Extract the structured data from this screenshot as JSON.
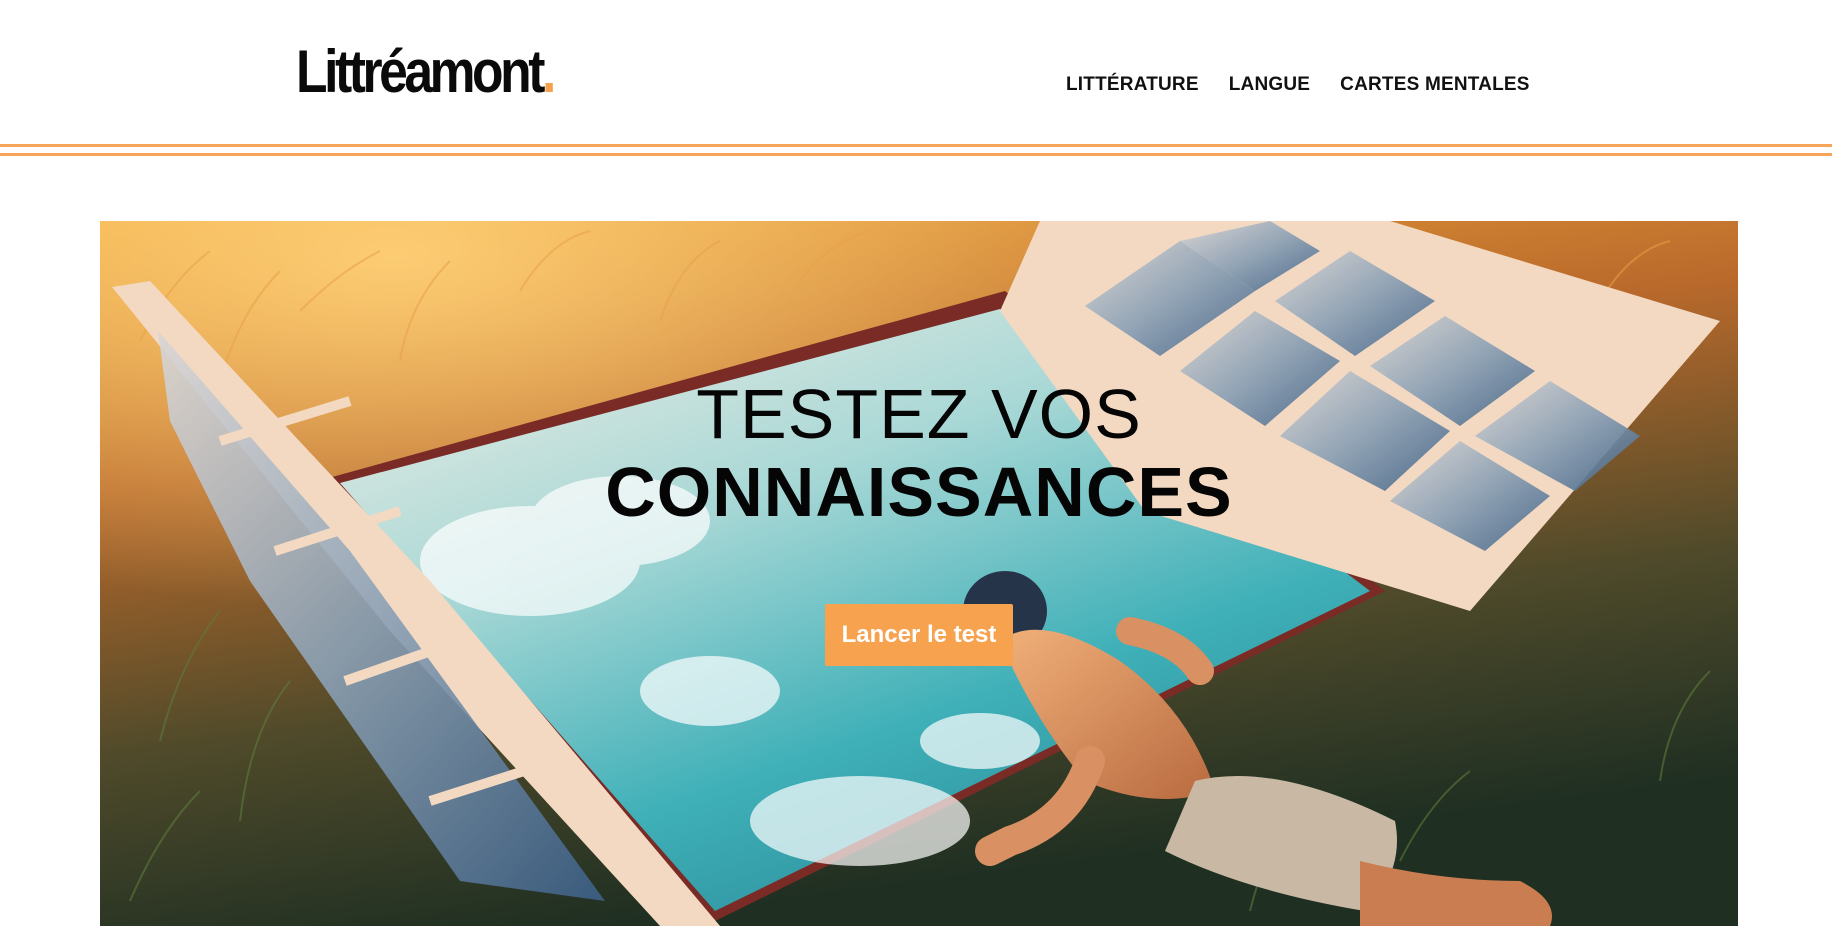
{
  "header": {
    "logo_text": "Littréamont",
    "logo_dot": ".",
    "nav": [
      {
        "label": "LITTÉRATURE"
      },
      {
        "label": "LANGUE"
      },
      {
        "label": "CARTES MENTALES"
      }
    ]
  },
  "hero": {
    "title_line1": "TESTEZ VOS",
    "title_line2": "CONNAISSANCES",
    "cta_label": "Lancer le test",
    "image_subject": "boy lying in grass looking through open window frames into a sky"
  },
  "colors": {
    "accent": "#f6a04d",
    "text": "#111111",
    "background": "#ffffff"
  }
}
